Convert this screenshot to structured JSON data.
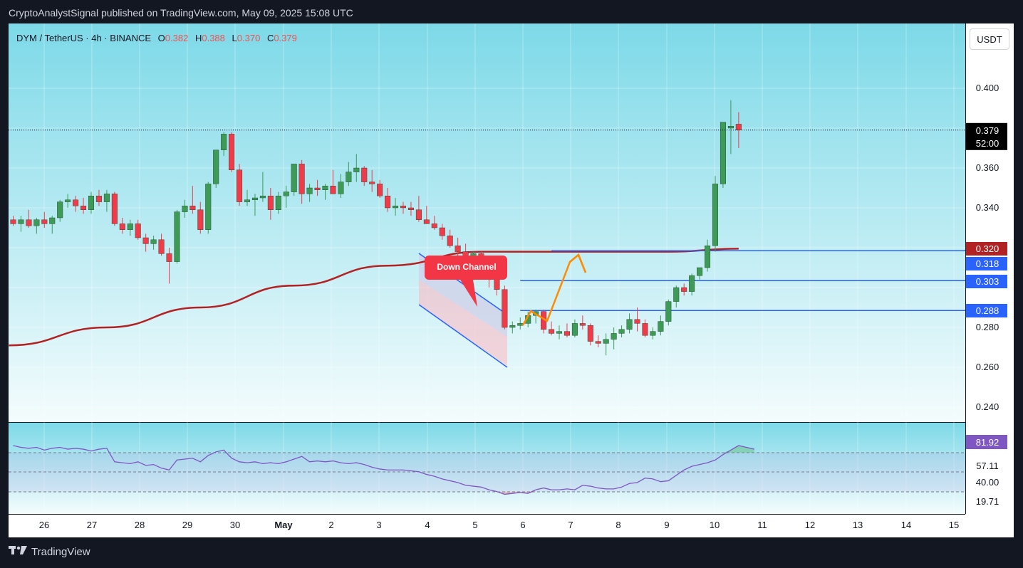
{
  "publisher_line": "CryptoAnalystSignal published on TradingView.com, May 09, 2025 15:08 UTC",
  "header": {
    "symbol": "DYM / TetherUS · 4h · BINANCE",
    "o_label": "O",
    "o_value": "0.382",
    "h_label": "H",
    "h_value": "0.388",
    "l_label": "L",
    "l_value": "0.370",
    "c_label": "C",
    "c_value": "0.379"
  },
  "currency_button": "USDT",
  "footer_brand": "TradingView",
  "colors": {
    "up": "#26a69a",
    "down": "#ef5350",
    "up_dark": "#2e7d32",
    "ma": "#b22222",
    "level_line": "#2962ff",
    "rsi_line": "#7e57c2",
    "arrow": "#ff8c00"
  },
  "chart_data": {
    "type": "candlestick",
    "symbol": "DYM / TetherUS",
    "timeframe": "4h",
    "exchange": "BINANCE",
    "y_ticks": [
      "0.400",
      "0.360",
      "0.340",
      "0.280",
      "0.260",
      "0.240"
    ],
    "ylim": [
      0.232,
      0.412
    ],
    "x_ticks": [
      "26",
      "27",
      "28",
      "29",
      "30",
      "May",
      "2",
      "3",
      "4",
      "5",
      "6",
      "7",
      "8",
      "9",
      "10",
      "11",
      "12",
      "13",
      "14",
      "15"
    ],
    "candles": [
      [
        0.334,
        0.336,
        0.331,
        0.332
      ],
      [
        0.332,
        0.336,
        0.328,
        0.334
      ],
      [
        0.334,
        0.339,
        0.33,
        0.331
      ],
      [
        0.331,
        0.335,
        0.327,
        0.334
      ],
      [
        0.334,
        0.338,
        0.33,
        0.332
      ],
      [
        0.332,
        0.336,
        0.327,
        0.335
      ],
      [
        0.335,
        0.344,
        0.333,
        0.343
      ],
      [
        0.343,
        0.347,
        0.34,
        0.344
      ],
      [
        0.344,
        0.346,
        0.338,
        0.341
      ],
      [
        0.341,
        0.345,
        0.337,
        0.339
      ],
      [
        0.339,
        0.348,
        0.337,
        0.346
      ],
      [
        0.346,
        0.349,
        0.341,
        0.343
      ],
      [
        0.343,
        0.349,
        0.338,
        0.347
      ],
      [
        0.347,
        0.348,
        0.331,
        0.332
      ],
      [
        0.332,
        0.335,
        0.327,
        0.329
      ],
      [
        0.329,
        0.334,
        0.326,
        0.332
      ],
      [
        0.332,
        0.334,
        0.324,
        0.325
      ],
      [
        0.325,
        0.327,
        0.318,
        0.322
      ],
      [
        0.322,
        0.326,
        0.319,
        0.324
      ],
      [
        0.324,
        0.327,
        0.316,
        0.317
      ],
      [
        0.317,
        0.32,
        0.302,
        0.313
      ],
      [
        0.313,
        0.339,
        0.312,
        0.338
      ],
      [
        0.338,
        0.344,
        0.335,
        0.341
      ],
      [
        0.341,
        0.351,
        0.337,
        0.339
      ],
      [
        0.339,
        0.343,
        0.327,
        0.329
      ],
      [
        0.329,
        0.353,
        0.327,
        0.352
      ],
      [
        0.352,
        0.367,
        0.35,
        0.369
      ],
      [
        0.369,
        0.378,
        0.366,
        0.377
      ],
      [
        0.377,
        0.378,
        0.358,
        0.359
      ],
      [
        0.359,
        0.362,
        0.341,
        0.343
      ],
      [
        0.343,
        0.349,
        0.341,
        0.344
      ],
      [
        0.344,
        0.347,
        0.336,
        0.345
      ],
      [
        0.345,
        0.358,
        0.343,
        0.346
      ],
      [
        0.346,
        0.35,
        0.334,
        0.339
      ],
      [
        0.339,
        0.348,
        0.337,
        0.346
      ],
      [
        0.346,
        0.351,
        0.34,
        0.348
      ],
      [
        0.348,
        0.362,
        0.346,
        0.362
      ],
      [
        0.362,
        0.364,
        0.342,
        0.347
      ],
      [
        0.347,
        0.352,
        0.343,
        0.35
      ],
      [
        0.35,
        0.354,
        0.346,
        0.349
      ],
      [
        0.349,
        0.352,
        0.344,
        0.351
      ],
      [
        0.351,
        0.359,
        0.347,
        0.347
      ],
      [
        0.347,
        0.357,
        0.345,
        0.353
      ],
      [
        0.353,
        0.363,
        0.351,
        0.358
      ],
      [
        0.358,
        0.367,
        0.353,
        0.36
      ],
      [
        0.36,
        0.361,
        0.351,
        0.353
      ],
      [
        0.353,
        0.359,
        0.348,
        0.352
      ],
      [
        0.352,
        0.354,
        0.345,
        0.346
      ],
      [
        0.346,
        0.35,
        0.338,
        0.34
      ],
      [
        0.34,
        0.345,
        0.336,
        0.341
      ],
      [
        0.341,
        0.343,
        0.337,
        0.34
      ],
      [
        0.34,
        0.343,
        0.336,
        0.339
      ],
      [
        0.339,
        0.346,
        0.333,
        0.334
      ],
      [
        0.334,
        0.341,
        0.332,
        0.332
      ],
      [
        0.332,
        0.336,
        0.329,
        0.33
      ],
      [
        0.33,
        0.332,
        0.324,
        0.326
      ],
      [
        0.326,
        0.329,
        0.32,
        0.321
      ],
      [
        0.321,
        0.325,
        0.316,
        0.318
      ],
      [
        0.318,
        0.322,
        0.311,
        0.313
      ],
      [
        0.313,
        0.318,
        0.308,
        0.317
      ],
      [
        0.317,
        0.318,
        0.305,
        0.307
      ],
      [
        0.307,
        0.311,
        0.3,
        0.304
      ],
      [
        0.304,
        0.306,
        0.296,
        0.299
      ],
      [
        0.299,
        0.301,
        0.279,
        0.28
      ],
      [
        0.28,
        0.283,
        0.277,
        0.281
      ],
      [
        0.281,
        0.285,
        0.279,
        0.282
      ],
      [
        0.282,
        0.288,
        0.28,
        0.286
      ],
      [
        0.286,
        0.289,
        0.282,
        0.288
      ],
      [
        0.288,
        0.289,
        0.277,
        0.279
      ],
      [
        0.279,
        0.283,
        0.276,
        0.277
      ],
      [
        0.277,
        0.281,
        0.274,
        0.278
      ],
      [
        0.278,
        0.282,
        0.275,
        0.276
      ],
      [
        0.276,
        0.284,
        0.275,
        0.282
      ],
      [
        0.282,
        0.286,
        0.279,
        0.281
      ],
      [
        0.281,
        0.282,
        0.271,
        0.273
      ],
      [
        0.273,
        0.276,
        0.27,
        0.272
      ],
      [
        0.272,
        0.277,
        0.266,
        0.274
      ],
      [
        0.274,
        0.28,
        0.269,
        0.277
      ],
      [
        0.277,
        0.281,
        0.275,
        0.279
      ],
      [
        0.279,
        0.287,
        0.277,
        0.284
      ],
      [
        0.284,
        0.29,
        0.278,
        0.282
      ],
      [
        0.282,
        0.284,
        0.275,
        0.276
      ],
      [
        0.276,
        0.28,
        0.274,
        0.278
      ],
      [
        0.278,
        0.286,
        0.276,
        0.283
      ],
      [
        0.283,
        0.294,
        0.281,
        0.293
      ],
      [
        0.293,
        0.301,
        0.29,
        0.3
      ],
      [
        0.3,
        0.302,
        0.296,
        0.298
      ],
      [
        0.298,
        0.307,
        0.296,
        0.306
      ],
      [
        0.306,
        0.31,
        0.304,
        0.31
      ],
      [
        0.31,
        0.324,
        0.308,
        0.321
      ],
      [
        0.321,
        0.356,
        0.318,
        0.352
      ],
      [
        0.352,
        0.383,
        0.35,
        0.383
      ],
      [
        0.38,
        0.394,
        0.367,
        0.381
      ],
      [
        0.382,
        0.388,
        0.37,
        0.379
      ]
    ],
    "ma_series": [
      0.271,
      0.28,
      0.29,
      0.301,
      0.311,
      0.318,
      0.318,
      0.318,
      0.3195
    ],
    "ma_anchor_candles": [
      0,
      12,
      24,
      36,
      48,
      60,
      72,
      84,
      93
    ],
    "levels": [
      {
        "label": "0.318",
        "price": 0.3185,
        "from_candle": 69
      },
      {
        "label": "0.303",
        "price": 0.3035,
        "from_candle": 65
      },
      {
        "label": "0.288",
        "price": 0.2885,
        "from_candle": 65
      }
    ],
    "price_labels": [
      {
        "text": "0.320",
        "kind": "ma"
      },
      {
        "text": "0.318",
        "kind": "level"
      },
      {
        "text": "0.303",
        "kind": "level"
      },
      {
        "text": "0.288",
        "kind": "level"
      }
    ],
    "last_price": {
      "value": "0.379",
      "countdown": "52:00"
    },
    "annotation": {
      "text": "Down Channel"
    },
    "rsi": {
      "value_label": "81.92",
      "levels": [
        "57.11",
        "40.00",
        "19.71"
      ],
      "ylim": [
        0,
        100
      ],
      "values": [
        82,
        80,
        79,
        80,
        77,
        79,
        80,
        78,
        79,
        78,
        76,
        78,
        79,
        64,
        63,
        62,
        64,
        60,
        61,
        57,
        55,
        66,
        67,
        68,
        64,
        71,
        75,
        77,
        68,
        64,
        63,
        64,
        62,
        63,
        62,
        64,
        67,
        70,
        64,
        65,
        64,
        65,
        63,
        62,
        63,
        61,
        58,
        56,
        55,
        55,
        55,
        54,
        53,
        50,
        48,
        45,
        43,
        41,
        38,
        37,
        36,
        33,
        31,
        28,
        29,
        30,
        29,
        33,
        35,
        33,
        33,
        34,
        33,
        38,
        37,
        35,
        34,
        34,
        36,
        40,
        41,
        46,
        45,
        42,
        43,
        49,
        55,
        59,
        61,
        63,
        66,
        72,
        77,
        82,
        80,
        78
      ]
    }
  }
}
